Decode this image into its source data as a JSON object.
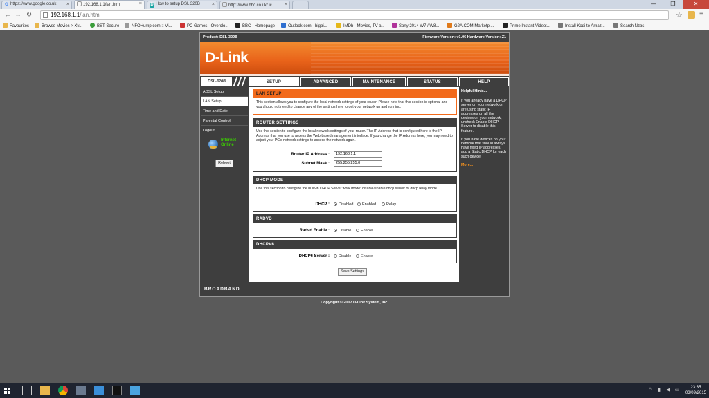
{
  "browser": {
    "tabs": [
      {
        "label": "https://www.google.co.uk",
        "icon": "G",
        "color": "#4285f4"
      },
      {
        "label": "192.168.1.1/lan.html",
        "icon": "",
        "color": "#888888"
      },
      {
        "label": "How to setup DSL 320B",
        "icon": "D",
        "color": "#1aa3a3"
      },
      {
        "label": "http://www.bbc.co.uk/ ic",
        "icon": "",
        "color": "#888888"
      }
    ],
    "address_host": "192.168.1.1",
    "address_path": "/lan.html",
    "window_controls": {
      "minimize": "—",
      "maximize": "❐",
      "close": "✕"
    },
    "bookmarks": [
      {
        "label": "Favourites",
        "color": "#e8b64c"
      },
      {
        "label": "Browse Movies > Xv...",
        "color": "#e8b64c"
      },
      {
        "label": "BST-Secure",
        "color": "#3a9d3a"
      },
      {
        "label": "NFOHump.com :: Vi...",
        "color": "#999999"
      },
      {
        "label": "PC Games - Overclo...",
        "color": "#cc3333"
      },
      {
        "label": "BBC - Homepage",
        "color": "#222222"
      },
      {
        "label": "Outlook.com - bigbi...",
        "color": "#2f6fd0"
      },
      {
        "label": "IMDb - Movies, TV a...",
        "color": "#e5b81a"
      },
      {
        "label": "Sony 2014 W7 / W8...",
        "color": "#b0339a"
      },
      {
        "label": "G2A.COM Marketpl...",
        "color": "#e07a1a"
      },
      {
        "label": "Prime Instant Video:...",
        "color": "#222222"
      },
      {
        "label": "Install Kodi to Amaz...",
        "color": "#777777"
      },
      {
        "label": "Search Nzbs",
        "color": "#777777"
      }
    ]
  },
  "router": {
    "product": "Product: DSL-320B",
    "firmware": "Firmware Version: v1.06 Hardware Version: Z1",
    "logo": "D-Link",
    "model_badge": "DSL-320B",
    "tabs": [
      "SETUP",
      "ADVANCED",
      "MAINTENANCE",
      "STATUS",
      "HELP"
    ],
    "nav": [
      "ADSL Setup",
      "LAN Setup",
      "Time and Date",
      "Parental Control",
      "Logout"
    ],
    "status": "Internet Online",
    "reboot": "Reboot",
    "lan_setup": {
      "title": "LAN SETUP",
      "text": "This section allows you to configure the local network settings of your router. Please note that this section is optional and you should not need to change any of the settings here to get your network up and running."
    },
    "router_settings": {
      "title": "ROUTER SETTINGS",
      "text": "Use this section to configure the local network settings of your router. The IP Address that is configured here is the IP Address that you use to access the Web-based management interface. If you change the IP Address here, you may need to adjust your PC's network settings to access the network again.",
      "ip_label": "Router IP Address :",
      "ip_value": "192.168.1.1",
      "mask_label": "Subnet Mask :",
      "mask_value": "255.255.255.0"
    },
    "dhcp": {
      "title": "DHCP MODE",
      "text": "Use this section to configure the built-in DHCP Server work mode: disable/enable dhcp server or dhcp relay mode.",
      "label": "DHCP :",
      "options": [
        "Disabled",
        "Enabled",
        "Relay"
      ]
    },
    "radvd": {
      "title": "RADVD",
      "label": "Radvd Enable :",
      "options": [
        "Disable",
        "Enable"
      ]
    },
    "dhcpv6": {
      "title": "DHCPV6",
      "label": "DHCP6 Server :",
      "options": [
        "Disable",
        "Enable"
      ]
    },
    "save": "Save Settings",
    "hints": {
      "title": "Helpful Hints...",
      "p1": "If you already have a DHCP server on your network or are using static IP addresses on all the devices on your network, uncheck Enable DHCP Server to disable this feature.",
      "p2": "If you have devices on your network that should always have fixed IP addresses, add a Static DHCP for each such device.",
      "more": "More..."
    },
    "footer": "BROADBAND",
    "copyright": "Copyright © 2007 D-Link System, Inc."
  },
  "taskbar": {
    "time": "23:35",
    "date": "03/09/2015"
  },
  "colors": {
    "dlink_orange": "#f26a1b",
    "dark_panel": "#3e3e3e",
    "online_green": "#3cd000"
  }
}
